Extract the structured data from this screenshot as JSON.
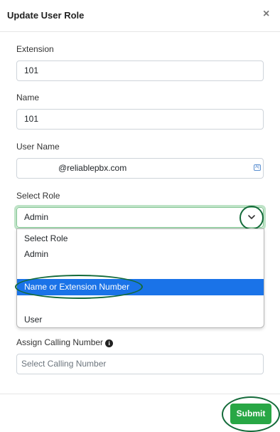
{
  "modal": {
    "title": "Update User Role",
    "close_glyph": "×"
  },
  "form": {
    "extension": {
      "label": "Extension",
      "value": "101"
    },
    "name": {
      "label": "Name",
      "value": "101"
    },
    "username": {
      "label": "User Name",
      "value": "@reliablepbx.com",
      "autofill_icon_text": "A|"
    },
    "role": {
      "label": "Select Role",
      "selected": "Admin",
      "options": [
        "Select Role",
        "Admin",
        "",
        "Name or Extension Number",
        "",
        "User"
      ],
      "highlighted_index": 3
    },
    "calling_number": {
      "label": "Assign Calling Number",
      "placeholder": "Select Calling Number",
      "info_icon": "i"
    }
  },
  "footer": {
    "submit_label": "Submit"
  },
  "colors": {
    "primary_highlight": "#1a73e8",
    "submit_green": "#28a745",
    "annotation_green": "#146b3a",
    "focus_green": "#86c796"
  }
}
